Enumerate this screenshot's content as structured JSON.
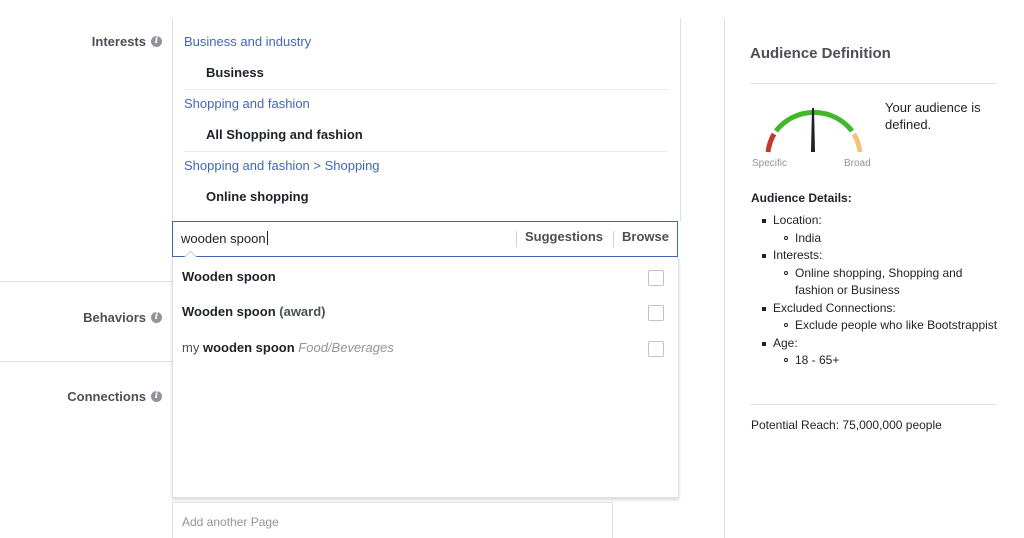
{
  "targeting": {
    "interests_label": "Interests",
    "behaviors_label": "Behaviors",
    "connections_label": "Connections",
    "selected_interests": [
      {
        "category": "Business and industry",
        "item": "Business"
      },
      {
        "category": "Shopping and fashion",
        "item": "All Shopping and fashion"
      },
      {
        "category": "Shopping and fashion > Shopping",
        "item": "Online shopping"
      }
    ],
    "search": {
      "value": "wooden spoon",
      "suggestions_label": "Suggestions",
      "browse_label": "Browse"
    },
    "results": [
      {
        "prefix": "",
        "name": "Wooden spoon",
        "sub": "",
        "category": ""
      },
      {
        "prefix": "",
        "name": "Wooden spoon",
        "sub": "(award)",
        "category": ""
      },
      {
        "prefix": "my ",
        "name": "wooden spoon",
        "sub": "",
        "category": "Food/Beverages"
      }
    ],
    "add_page_placeholder": "Add another Page"
  },
  "audience": {
    "title": "Audience Definition",
    "status": "Your audience is defined.",
    "gauge_low": "Specific",
    "gauge_high": "Broad",
    "details_title": "Audience Details:",
    "details": [
      {
        "label": "Location:",
        "values": [
          "India"
        ]
      },
      {
        "label": "Interests:",
        "values": [
          "Online shopping, Shopping and fashion or Business"
        ]
      },
      {
        "label": "Excluded Connections:",
        "values": [
          "Exclude people who like Bootstrappist"
        ]
      },
      {
        "label": "Age:",
        "values": [
          "18 - 65+"
        ]
      }
    ],
    "potential_reach": "Potential Reach: 75,000,000 people"
  },
  "colors": {
    "link": "#4267b2",
    "gauge_red": "#c0392b",
    "gauge_green": "#42b72a",
    "gauge_orange": "#f5c27b"
  }
}
